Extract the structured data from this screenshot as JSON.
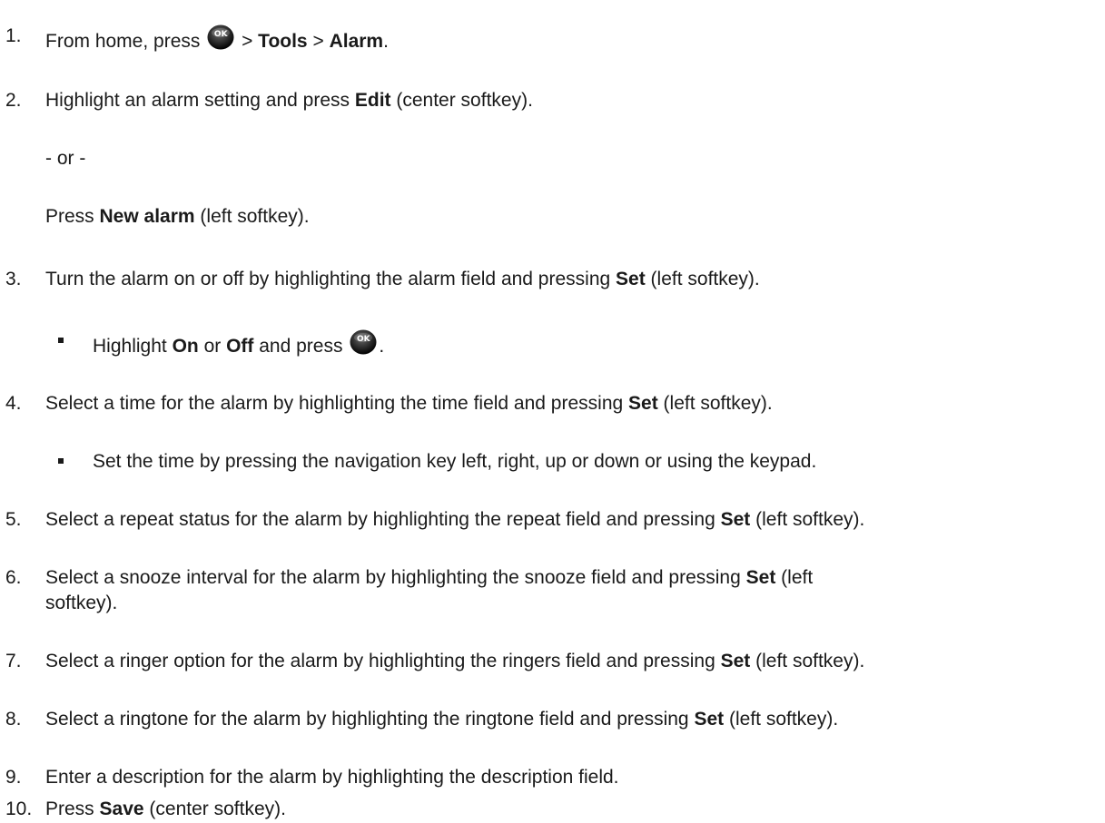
{
  "ok_key_label": "OK",
  "steps": [
    {
      "num": "1.",
      "parts": [
        "From home, press",
        " > ",
        "Tools",
        " > ",
        "Alarm",
        "."
      ]
    },
    {
      "num": "2.",
      "parts": [
        "Highlight an alarm setting and press ",
        "Edit",
        " (center softkey)."
      ]
    },
    {
      "or_line": "- or -",
      "press_parts": [
        "Press ",
        "New alarm",
        " (left softkey)."
      ]
    },
    {
      "num": "3.",
      "parts": [
        "Turn the alarm on or off by highlighting the alarm field and pressing ",
        "Set",
        " (left softkey)."
      ],
      "sub": [
        "Highlight ",
        "On",
        " or ",
        "Off",
        " and press",
        "."
      ]
    },
    {
      "num": "4.",
      "parts": [
        "Select a time for the alarm by highlighting the time field and pressing ",
        "Set",
        " (left softkey)."
      ],
      "sub": "Set the time by pressing the navigation key left, right, up or down or using the keypad."
    },
    {
      "num": "5.",
      "parts": [
        "Select a repeat status for the alarm by highlighting the repeat field and pressing ",
        "Set",
        " (left softkey)."
      ]
    },
    {
      "num": "6.",
      "parts": [
        "Select a snooze interval for the alarm by highlighting the snooze field and pressing ",
        "Set",
        " (left"
      ],
      "cont": "softkey)."
    },
    {
      "num": "7.",
      "parts": [
        "Select a ringer option for the alarm by highlighting the ringers field and pressing ",
        "Set",
        " (left softkey)."
      ]
    },
    {
      "num": "8.",
      "parts": [
        "Select a ringtone for the alarm by highlighting the ringtone field and pressing ",
        "Set",
        " (left softkey)."
      ]
    },
    {
      "num": "9.",
      "parts": [
        "Enter a description for the alarm by highlighting the description field."
      ]
    },
    {
      "num": "10.",
      "parts": [
        "Press ",
        "Save",
        " (center softkey)."
      ]
    }
  ]
}
